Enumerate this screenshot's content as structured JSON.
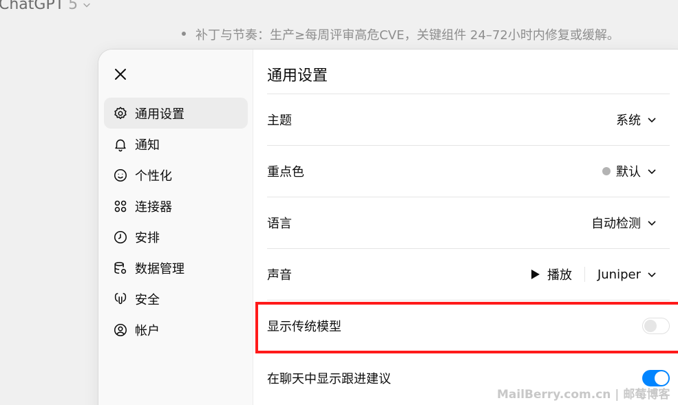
{
  "background": {
    "app_title": "ChatGPT",
    "app_version": "5",
    "chat_line": "补丁与节奏：生产≥每周评审高危CVE，关键组件 24–72小时内修复或缓解。"
  },
  "sidebar": {
    "items": [
      {
        "label": "通用设置",
        "icon": "gear-icon"
      },
      {
        "label": "通知",
        "icon": "bell-icon"
      },
      {
        "label": "个性化",
        "icon": "smile-icon"
      },
      {
        "label": "连接器",
        "icon": "connectors-icon"
      },
      {
        "label": "安排",
        "icon": "clock-icon"
      },
      {
        "label": "数据管理",
        "icon": "database-icon"
      },
      {
        "label": "安全",
        "icon": "shield-icon"
      },
      {
        "label": "帐户",
        "icon": "account-icon"
      }
    ]
  },
  "content": {
    "title": "通用设置",
    "theme": {
      "label": "主题",
      "value": "系统"
    },
    "accent": {
      "label": "重点色",
      "value": "默认",
      "color": "#b3b3b3"
    },
    "language": {
      "label": "语言",
      "value": "自动检测"
    },
    "voice": {
      "label": "声音",
      "play_label": "播放",
      "value": "Juniper"
    },
    "legacy_models": {
      "label": "显示传统模型",
      "enabled": false
    },
    "follow_up": {
      "label": "在聊天中显示跟进建议",
      "enabled": true
    }
  },
  "colors": {
    "highlight": "#ff1a1a",
    "toggle_on": "#0285ff"
  },
  "watermark": "MailBerry.com.cn | 邮莓博客"
}
